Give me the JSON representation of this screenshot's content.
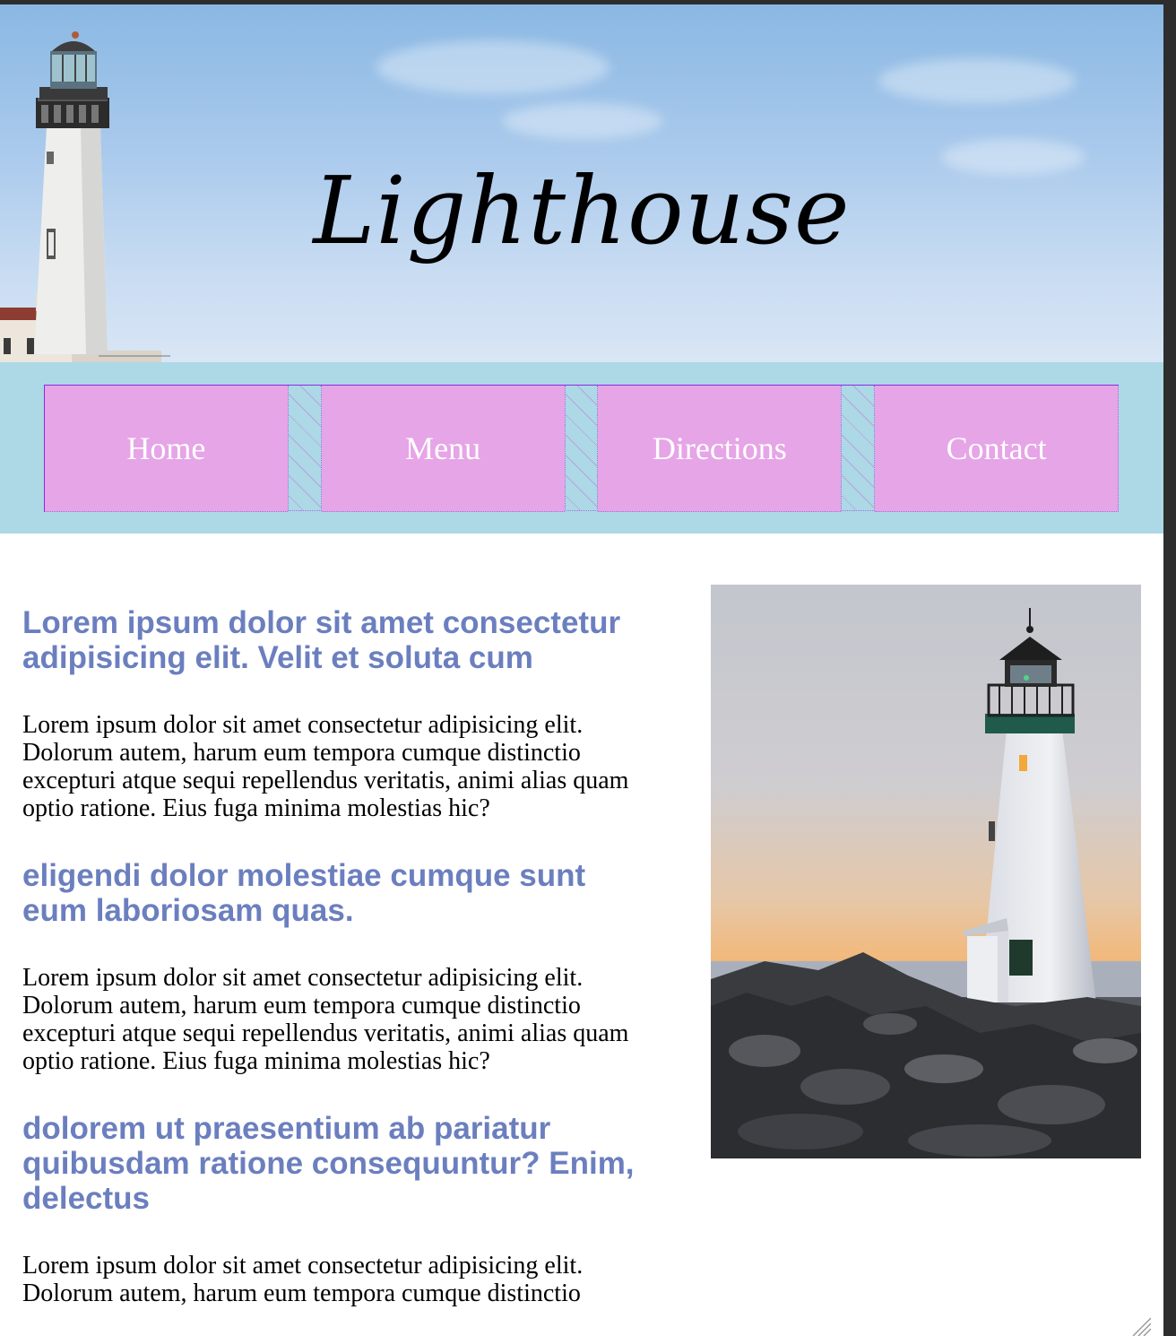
{
  "header": {
    "site_title": "Lighthouse"
  },
  "nav": {
    "items": [
      {
        "label": "Home"
      },
      {
        "label": "Menu"
      },
      {
        "label": "Directions"
      },
      {
        "label": "Contact"
      }
    ]
  },
  "article": {
    "sections": [
      {
        "heading": "Lorem ipsum dolor sit amet consectetur adipisicing elit. Velit et soluta cum",
        "body": "Lorem ipsum dolor sit amet consectetur adipisicing elit. Dolorum autem, harum eum tempora cumque distinctio excepturi atque sequi repellendus veritatis, animi alias quam optio ratione. Eius fuga minima molestias hic?"
      },
      {
        "heading": "eligendi dolor molestiae cumque sunt eum laboriosam quas.",
        "body": "Lorem ipsum dolor sit amet consectetur adipisicing elit. Dolorum autem, harum eum tempora cumque distinctio excepturi atque sequi repellendus veritatis, animi alias quam optio ratione. Eius fuga minima molestias hic?"
      },
      {
        "heading": "dolorem ut praesentium ab pariatur quibusdam ratione consequuntur? Enim, delectus",
        "body": "Lorem ipsum dolor sit amet consectetur adipisicing elit. Dolorum autem, harum eum tempora cumque distinctio"
      }
    ]
  },
  "colors": {
    "nav_band": "#add8e6",
    "nav_item": "#e6a5e6",
    "heading": "#6b7fbf"
  }
}
